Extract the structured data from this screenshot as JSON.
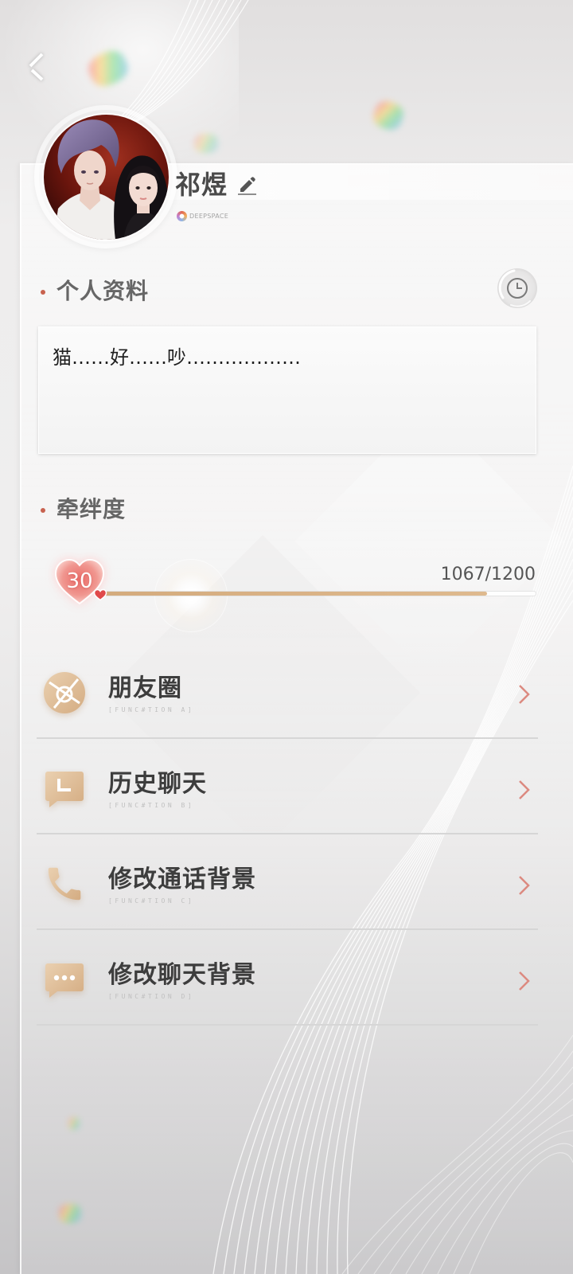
{
  "app": {
    "back_icon": "chevron-left-icon",
    "colors": {
      "accent": "#c8624f",
      "chevron": "#dc8a80",
      "icon_tan": "#d4ac82",
      "progress_fill": "#deb98e",
      "text_dark": "#3d3d3d"
    }
  },
  "profile": {
    "name": "祁煜",
    "edit_icon": "pencil-icon",
    "logo_text": "DEEPSPACE"
  },
  "info_section": {
    "title": "个人资料",
    "history_icon": "clock-icon",
    "bio": "猫……好……吵………………"
  },
  "bond_section": {
    "title": "牵绊度",
    "level": "30",
    "level_icon": "heart-icon",
    "current": 1067,
    "max": 1200,
    "progress_text": "1067/1200"
  },
  "menu": [
    {
      "label": "朋友圈",
      "sub": "[FUNC#TION A]",
      "icon": "aperture-icon",
      "arrow_icon": "chevron-right-icon"
    },
    {
      "label": "历史聊天",
      "sub": "[FUNC#TION B]",
      "icon": "chat-clock-icon",
      "arrow_icon": "chevron-right-icon"
    },
    {
      "label": "修改通话背景",
      "sub": "[FUNC#TION C]",
      "icon": "phone-icon",
      "arrow_icon": "chevron-right-icon"
    },
    {
      "label": "修改聊天背景",
      "sub": "[FUNC#TION D]",
      "icon": "chat-dots-icon",
      "arrow_icon": "chevron-right-icon"
    }
  ]
}
